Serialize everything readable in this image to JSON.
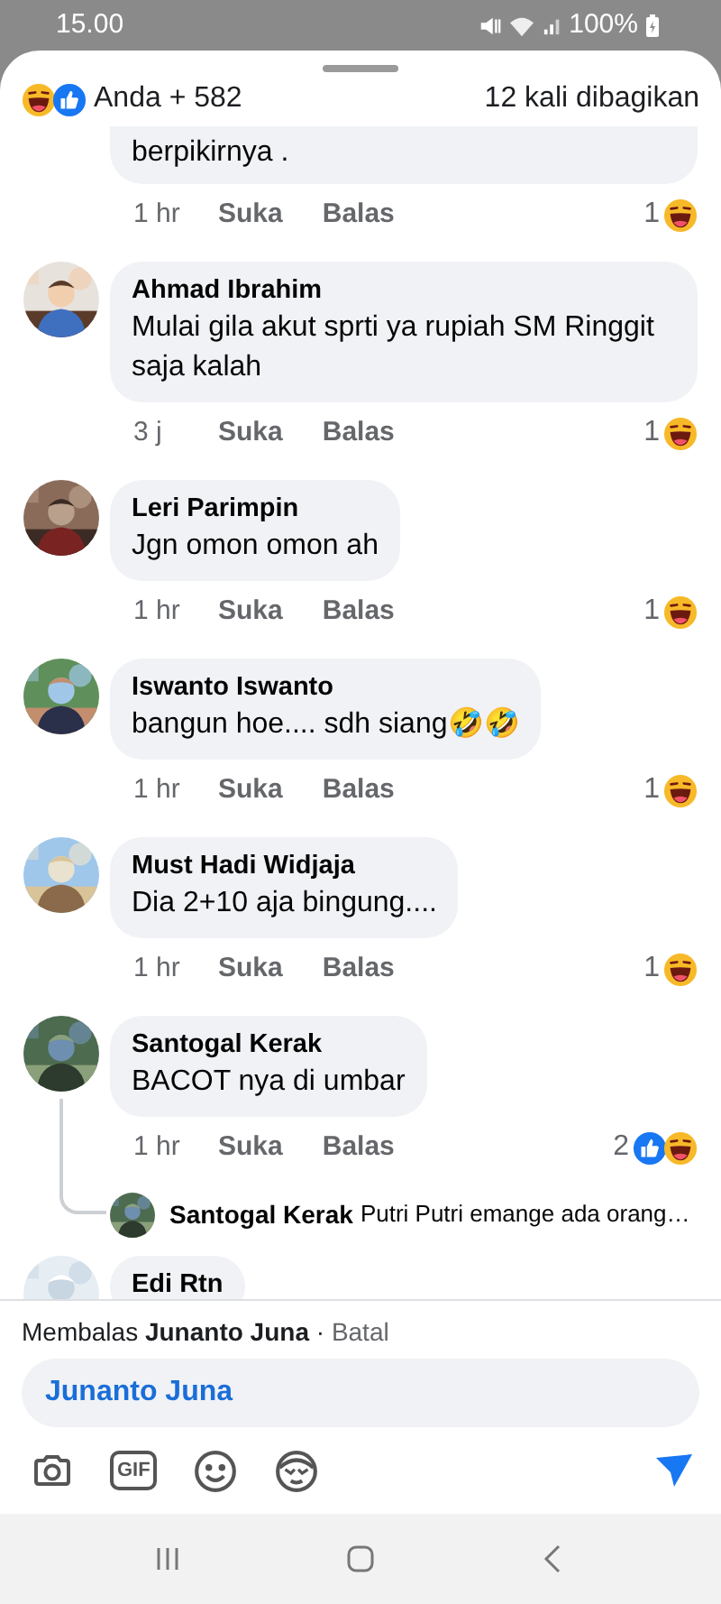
{
  "status_bar": {
    "time": "15.00",
    "battery": "100%"
  },
  "header": {
    "reactions": [
      {
        "kind": "haha"
      },
      {
        "kind": "like"
      }
    ],
    "reactors": "Anda + 582",
    "shares": "12 kali dibagikan"
  },
  "comments": [
    {
      "text": "berpikirnya .",
      "time": "1 hr",
      "like_label": "Suka",
      "reply_label": "Balas",
      "reaction_count": "1",
      "reactions": [
        {
          "kind": "haha"
        }
      ],
      "clipped_top": true
    },
    {
      "name": "Ahmad Ibrahim",
      "text": "Mulai gila akut sprti ya rupiah SM Ringgit saja kalah",
      "time": "3 j",
      "like_label": "Suka",
      "reply_label": "Balas",
      "reaction_count": "1",
      "reactions": [
        {
          "kind": "haha"
        }
      ]
    },
    {
      "name": "Leri Parimpin",
      "text": "Jgn omon omon ah",
      "time": "1 hr",
      "like_label": "Suka",
      "reply_label": "Balas",
      "reaction_count": "1",
      "reactions": [
        {
          "kind": "haha"
        }
      ]
    },
    {
      "name": "Iswanto Iswanto",
      "text": "bangun hoe.... sdh siang🤣🤣",
      "time": "1 hr",
      "like_label": "Suka",
      "reply_label": "Balas",
      "reaction_count": "1",
      "reactions": [
        {
          "kind": "haha"
        }
      ]
    },
    {
      "name": "Must Hadi Widjaja",
      "text": "Dia 2+10 aja bingung....",
      "time": "1 hr",
      "like_label": "Suka",
      "reply_label": "Balas",
      "reaction_count": "1",
      "reactions": [
        {
          "kind": "haha"
        }
      ]
    },
    {
      "name": "Santogal Kerak",
      "text": "BACOT nya di umbar",
      "time": "1 hr",
      "like_label": "Suka",
      "reply_label": "Balas",
      "reaction_count": "2",
      "reactions": [
        {
          "kind": "like"
        },
        {
          "kind": "haha"
        }
      ],
      "replies": [
        {
          "name": "Santogal Kerak",
          "text": "Putri Putri emange ada orang…"
        }
      ]
    },
    {
      "name": "Edi Rtn"
    }
  ],
  "composer": {
    "replying_prefix": "Membalas",
    "replying_to": "Junanto Juna",
    "separator": "·",
    "cancel": "Batal",
    "value": "Junanto Juna",
    "gif_label": "GIF"
  }
}
